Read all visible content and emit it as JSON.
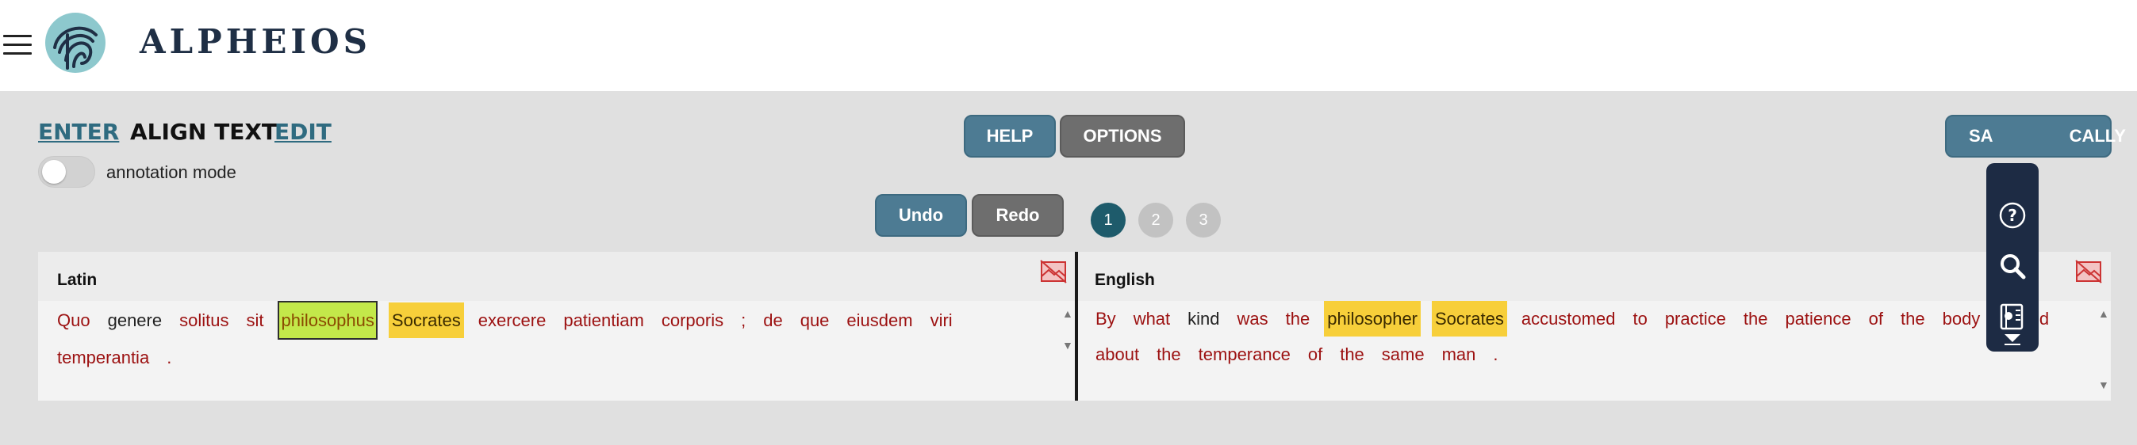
{
  "header": {
    "menu_icon": "hamburger-menu-icon",
    "logo_icon": "alpheios-logo-icon",
    "logo_text": "ALPHEIOS"
  },
  "nav": {
    "enter": "ENTER",
    "align_text": "ALIGN TEXT",
    "edit": "EDIT"
  },
  "annotation": {
    "label": "annotation mode",
    "enabled": false
  },
  "buttons": {
    "help": "HELP",
    "options": "OPTIONS",
    "save_locally_visible": "SA",
    "save_locally_tail": "CALLY",
    "undo": "Undo",
    "redo": "Redo"
  },
  "steps": [
    "1",
    "2",
    "3"
  ],
  "active_step": "1",
  "origin": {
    "title": "Latin",
    "tokens": [
      {
        "text": "Quo",
        "style": "red"
      },
      {
        "text": "genere",
        "style": "plain"
      },
      {
        "text": "solitus",
        "style": "red"
      },
      {
        "text": "sit",
        "style": "red"
      },
      {
        "text": "philosophus",
        "style": "sel"
      },
      {
        "text": "Socrates",
        "style": "hl"
      },
      {
        "text": "exercere",
        "style": "red"
      },
      {
        "text": "patientiam",
        "style": "red"
      },
      {
        "text": "corporis",
        "style": "red"
      },
      {
        "text": ";",
        "style": "red"
      },
      {
        "text": "de",
        "style": "red"
      },
      {
        "text": "que",
        "style": "red"
      },
      {
        "text": "eiusdem",
        "style": "red"
      },
      {
        "text": "viri",
        "style": "red"
      },
      {
        "text": "temperantia",
        "style": "red"
      },
      {
        "text": ".",
        "style": "red"
      }
    ]
  },
  "target": {
    "title": "English",
    "tokens": [
      {
        "text": "By",
        "style": "red"
      },
      {
        "text": "what",
        "style": "red"
      },
      {
        "text": "kind",
        "style": "plain"
      },
      {
        "text": "was",
        "style": "red"
      },
      {
        "text": "the",
        "style": "red"
      },
      {
        "text": "philosopher",
        "style": "hl"
      },
      {
        "text": "Socrates",
        "style": "hl"
      },
      {
        "text": "accustomed",
        "style": "red"
      },
      {
        "text": "to",
        "style": "red"
      },
      {
        "text": "practice",
        "style": "red"
      },
      {
        "text": "the",
        "style": "red"
      },
      {
        "text": "patience",
        "style": "red"
      },
      {
        "text": "of",
        "style": "red"
      },
      {
        "text": "the",
        "style": "red"
      },
      {
        "text": "body",
        "style": "red"
      },
      {
        "text": ";",
        "style": "red"
      },
      {
        "text": "and",
        "style": "red"
      },
      {
        "text": "about",
        "style": "red"
      },
      {
        "text": "the",
        "style": "red"
      },
      {
        "text": "temperance",
        "style": "red"
      },
      {
        "text": "of",
        "style": "red"
      },
      {
        "text": "the",
        "style": "red"
      },
      {
        "text": "same",
        "style": "red"
      },
      {
        "text": "man",
        "style": "red"
      },
      {
        "text": ".",
        "style": "red"
      }
    ]
  },
  "toolbar": {
    "icons": [
      "help-circle-icon",
      "search-icon",
      "reading-tools-icon",
      "expand-down-icon"
    ]
  },
  "colors": {
    "accent_blue": "#4d7b93",
    "dark_gray_button": "#6e6e6e",
    "token_red": "#9c1111",
    "highlight_yellow": "#f7cf3a",
    "selected_green": "#c3e84a",
    "toolbar_navy": "#1d2b44",
    "logo_teal": "#8dc8cd"
  }
}
